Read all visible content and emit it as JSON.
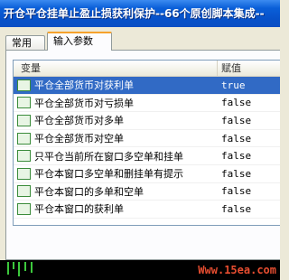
{
  "window": {
    "title": "开仓平仓挂单止盈止损获利保护--66个原创脚本集成--"
  },
  "tabs": [
    {
      "label": "常用",
      "active": false
    },
    {
      "label": "输入参数",
      "active": true
    }
  ],
  "grid": {
    "columns": [
      "变量",
      "赋值"
    ],
    "rows": [
      {
        "name": "平仓全部货币对获利单",
        "value": "true",
        "selected": true
      },
      {
        "name": "平仓全部货币对亏损单",
        "value": "false",
        "selected": false
      },
      {
        "name": "平仓全部货币对多单",
        "value": "false",
        "selected": false
      },
      {
        "name": "平仓全部货币对空单",
        "value": "false",
        "selected": false
      },
      {
        "name": "只平仓当前所在窗口多空单和挂单",
        "value": "false",
        "selected": false
      },
      {
        "name": "平仓本窗口多空单和删挂单有提示",
        "value": "false",
        "selected": false
      },
      {
        "name": "平仓本窗口的多单和空单",
        "value": "false",
        "selected": false
      },
      {
        "name": "平仓本窗口的获利单",
        "value": "false",
        "selected": false
      }
    ]
  },
  "watermark": "Www.15ea.com",
  "colors": {
    "titlebar": "#0A5FD8",
    "selected_row": "#316AC5",
    "tab_highlight": "#F6A22C",
    "watermark": "#E64D30"
  }
}
